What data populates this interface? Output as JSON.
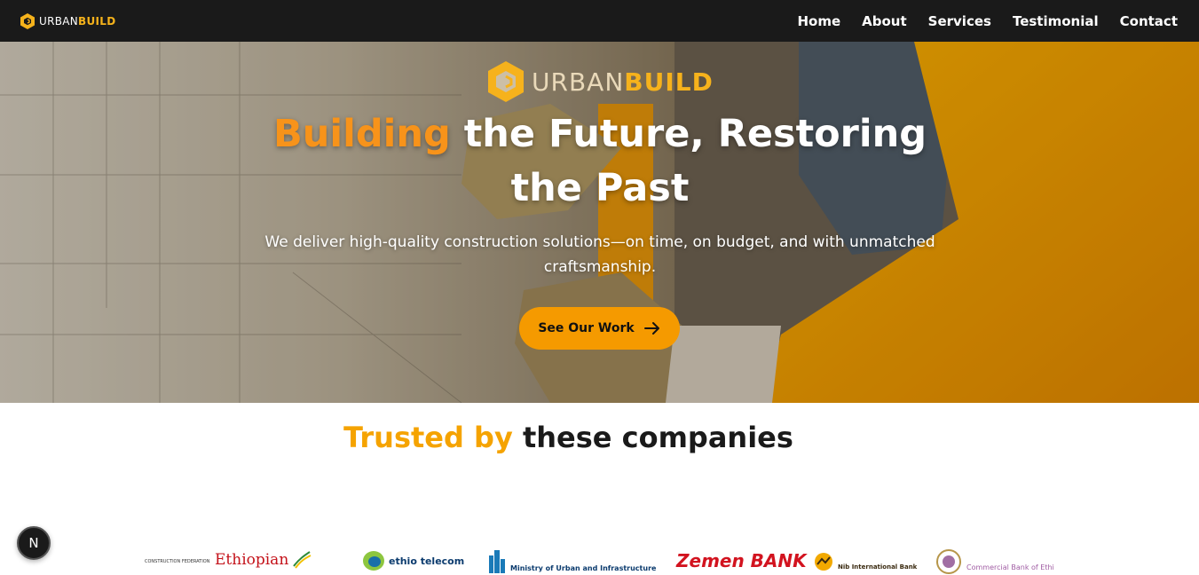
{
  "nav": {
    "brand": {
      "part1": "URBAN",
      "part2": "BUILD"
    },
    "links": [
      "Home",
      "About",
      "Services",
      "Testimonial",
      "Contact"
    ]
  },
  "hero": {
    "logo": {
      "part1": "URBAN",
      "part2": "BUILD"
    },
    "title_accent": "Building",
    "title_rest": " the Future, Restoring the Past",
    "subtitle": "We deliver high-quality construction solutions—on time, on budget, and with unmatched craftsmanship.",
    "cta_label": "See Our Work"
  },
  "trusted": {
    "title_accent": "Trusted by",
    "title_rest": " these companies",
    "logos": [
      {
        "name": "CONSTRUCTION FEDERATION"
      },
      {
        "name": "Ethiopian"
      },
      {
        "name": "ethio telecom"
      },
      {
        "name": "Ministry of Urban and Infrastructure"
      },
      {
        "name": "Zemen BANK"
      },
      {
        "name": "Nib International Bank"
      },
      {
        "name": "Commercial Bank of Ethi"
      }
    ]
  },
  "badge": {
    "letter": "N"
  },
  "colors": {
    "accent": "#f5a300",
    "nav_bg": "#1a1a1a",
    "cta": "#f59a00"
  }
}
